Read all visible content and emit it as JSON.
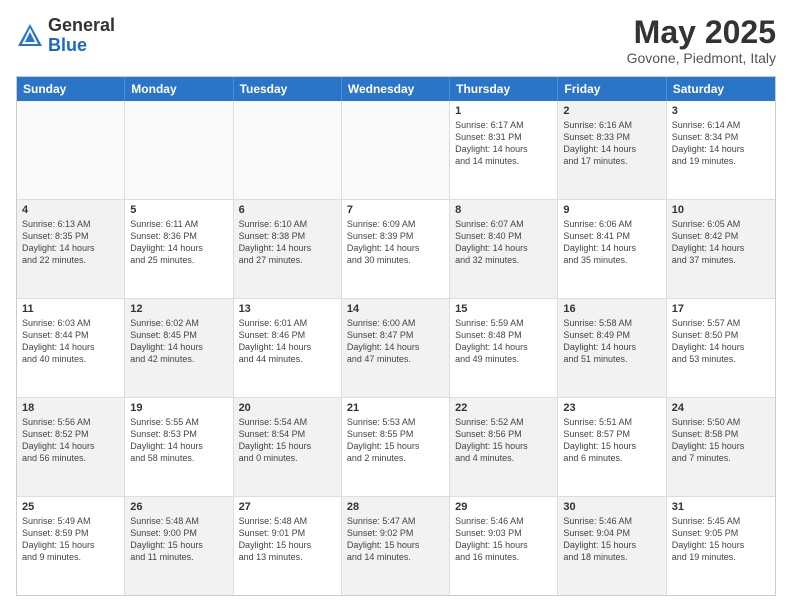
{
  "header": {
    "logo_general": "General",
    "logo_blue": "Blue",
    "title": "May 2025",
    "subtitle": "Govone, Piedmont, Italy"
  },
  "weekdays": [
    "Sunday",
    "Monday",
    "Tuesday",
    "Wednesday",
    "Thursday",
    "Friday",
    "Saturday"
  ],
  "rows": [
    [
      {
        "day": "",
        "info": "",
        "shaded": false,
        "empty": true
      },
      {
        "day": "",
        "info": "",
        "shaded": false,
        "empty": true
      },
      {
        "day": "",
        "info": "",
        "shaded": false,
        "empty": true
      },
      {
        "day": "",
        "info": "",
        "shaded": false,
        "empty": true
      },
      {
        "day": "1",
        "info": "Sunrise: 6:17 AM\nSunset: 8:31 PM\nDaylight: 14 hours\nand 14 minutes.",
        "shaded": false,
        "empty": false
      },
      {
        "day": "2",
        "info": "Sunrise: 6:16 AM\nSunset: 8:33 PM\nDaylight: 14 hours\nand 17 minutes.",
        "shaded": true,
        "empty": false
      },
      {
        "day": "3",
        "info": "Sunrise: 6:14 AM\nSunset: 8:34 PM\nDaylight: 14 hours\nand 19 minutes.",
        "shaded": false,
        "empty": false
      }
    ],
    [
      {
        "day": "4",
        "info": "Sunrise: 6:13 AM\nSunset: 8:35 PM\nDaylight: 14 hours\nand 22 minutes.",
        "shaded": true,
        "empty": false
      },
      {
        "day": "5",
        "info": "Sunrise: 6:11 AM\nSunset: 8:36 PM\nDaylight: 14 hours\nand 25 minutes.",
        "shaded": false,
        "empty": false
      },
      {
        "day": "6",
        "info": "Sunrise: 6:10 AM\nSunset: 8:38 PM\nDaylight: 14 hours\nand 27 minutes.",
        "shaded": true,
        "empty": false
      },
      {
        "day": "7",
        "info": "Sunrise: 6:09 AM\nSunset: 8:39 PM\nDaylight: 14 hours\nand 30 minutes.",
        "shaded": false,
        "empty": false
      },
      {
        "day": "8",
        "info": "Sunrise: 6:07 AM\nSunset: 8:40 PM\nDaylight: 14 hours\nand 32 minutes.",
        "shaded": true,
        "empty": false
      },
      {
        "day": "9",
        "info": "Sunrise: 6:06 AM\nSunset: 8:41 PM\nDaylight: 14 hours\nand 35 minutes.",
        "shaded": false,
        "empty": false
      },
      {
        "day": "10",
        "info": "Sunrise: 6:05 AM\nSunset: 8:42 PM\nDaylight: 14 hours\nand 37 minutes.",
        "shaded": true,
        "empty": false
      }
    ],
    [
      {
        "day": "11",
        "info": "Sunrise: 6:03 AM\nSunset: 8:44 PM\nDaylight: 14 hours\nand 40 minutes.",
        "shaded": false,
        "empty": false
      },
      {
        "day": "12",
        "info": "Sunrise: 6:02 AM\nSunset: 8:45 PM\nDaylight: 14 hours\nand 42 minutes.",
        "shaded": true,
        "empty": false
      },
      {
        "day": "13",
        "info": "Sunrise: 6:01 AM\nSunset: 8:46 PM\nDaylight: 14 hours\nand 44 minutes.",
        "shaded": false,
        "empty": false
      },
      {
        "day": "14",
        "info": "Sunrise: 6:00 AM\nSunset: 8:47 PM\nDaylight: 14 hours\nand 47 minutes.",
        "shaded": true,
        "empty": false
      },
      {
        "day": "15",
        "info": "Sunrise: 5:59 AM\nSunset: 8:48 PM\nDaylight: 14 hours\nand 49 minutes.",
        "shaded": false,
        "empty": false
      },
      {
        "day": "16",
        "info": "Sunrise: 5:58 AM\nSunset: 8:49 PM\nDaylight: 14 hours\nand 51 minutes.",
        "shaded": true,
        "empty": false
      },
      {
        "day": "17",
        "info": "Sunrise: 5:57 AM\nSunset: 8:50 PM\nDaylight: 14 hours\nand 53 minutes.",
        "shaded": false,
        "empty": false
      }
    ],
    [
      {
        "day": "18",
        "info": "Sunrise: 5:56 AM\nSunset: 8:52 PM\nDaylight: 14 hours\nand 56 minutes.",
        "shaded": true,
        "empty": false
      },
      {
        "day": "19",
        "info": "Sunrise: 5:55 AM\nSunset: 8:53 PM\nDaylight: 14 hours\nand 58 minutes.",
        "shaded": false,
        "empty": false
      },
      {
        "day": "20",
        "info": "Sunrise: 5:54 AM\nSunset: 8:54 PM\nDaylight: 15 hours\nand 0 minutes.",
        "shaded": true,
        "empty": false
      },
      {
        "day": "21",
        "info": "Sunrise: 5:53 AM\nSunset: 8:55 PM\nDaylight: 15 hours\nand 2 minutes.",
        "shaded": false,
        "empty": false
      },
      {
        "day": "22",
        "info": "Sunrise: 5:52 AM\nSunset: 8:56 PM\nDaylight: 15 hours\nand 4 minutes.",
        "shaded": true,
        "empty": false
      },
      {
        "day": "23",
        "info": "Sunrise: 5:51 AM\nSunset: 8:57 PM\nDaylight: 15 hours\nand 6 minutes.",
        "shaded": false,
        "empty": false
      },
      {
        "day": "24",
        "info": "Sunrise: 5:50 AM\nSunset: 8:58 PM\nDaylight: 15 hours\nand 7 minutes.",
        "shaded": true,
        "empty": false
      }
    ],
    [
      {
        "day": "25",
        "info": "Sunrise: 5:49 AM\nSunset: 8:59 PM\nDaylight: 15 hours\nand 9 minutes.",
        "shaded": false,
        "empty": false
      },
      {
        "day": "26",
        "info": "Sunrise: 5:48 AM\nSunset: 9:00 PM\nDaylight: 15 hours\nand 11 minutes.",
        "shaded": true,
        "empty": false
      },
      {
        "day": "27",
        "info": "Sunrise: 5:48 AM\nSunset: 9:01 PM\nDaylight: 15 hours\nand 13 minutes.",
        "shaded": false,
        "empty": false
      },
      {
        "day": "28",
        "info": "Sunrise: 5:47 AM\nSunset: 9:02 PM\nDaylight: 15 hours\nand 14 minutes.",
        "shaded": true,
        "empty": false
      },
      {
        "day": "29",
        "info": "Sunrise: 5:46 AM\nSunset: 9:03 PM\nDaylight: 15 hours\nand 16 minutes.",
        "shaded": false,
        "empty": false
      },
      {
        "day": "30",
        "info": "Sunrise: 5:46 AM\nSunset: 9:04 PM\nDaylight: 15 hours\nand 18 minutes.",
        "shaded": true,
        "empty": false
      },
      {
        "day": "31",
        "info": "Sunrise: 5:45 AM\nSunset: 9:05 PM\nDaylight: 15 hours\nand 19 minutes.",
        "shaded": false,
        "empty": false
      }
    ]
  ]
}
